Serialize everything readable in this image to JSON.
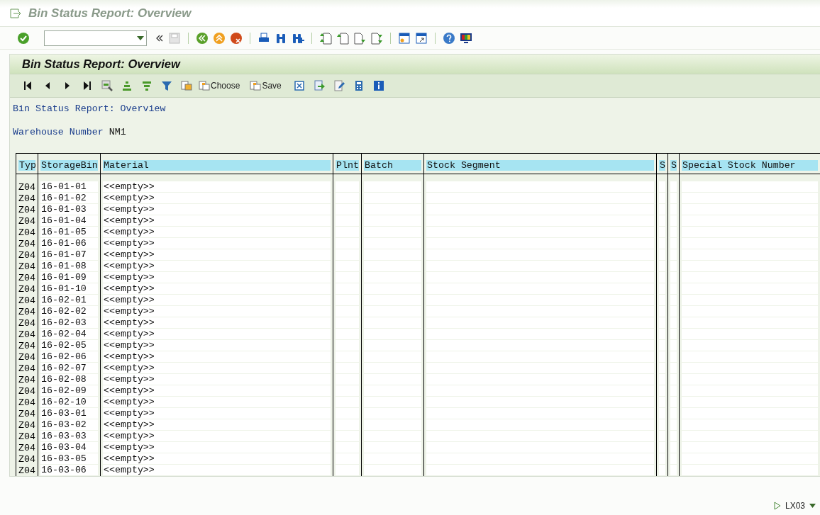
{
  "window": {
    "title": "Bin Status Report: Overview"
  },
  "panel": {
    "title": "Bin Status Report: Overview"
  },
  "app_toolbar": [
    {
      "kind": "icon"
    },
    {
      "kind": "icon"
    },
    {
      "kind": "icon"
    },
    {
      "kind": "icon"
    },
    {
      "kind": "icon"
    },
    {
      "kind": "icon"
    },
    {
      "kind": "icon"
    },
    {
      "kind": "icon"
    },
    {
      "kind": "icon"
    },
    {
      "kind": "text",
      "label": "Choose"
    },
    {
      "kind": "text",
      "label": "Save"
    },
    {
      "kind": "icon"
    },
    {
      "kind": "icon"
    },
    {
      "kind": "icon"
    },
    {
      "kind": "icon"
    },
    {
      "kind": "icon"
    }
  ],
  "report": {
    "heading": "Bin Status Report: Overview",
    "warehouse_label": "Warehouse Number",
    "warehouse_value": "NM1"
  },
  "table": {
    "columns": [
      "Typ",
      "StorageBin",
      "Material",
      "Plnt",
      "Batch",
      "Stock Segment",
      "S",
      "S",
      "Special Stock Number"
    ],
    "rows": [
      [
        "Z04",
        "16-01-01",
        "<<empty>>"
      ],
      [
        "Z04",
        "16-01-02",
        "<<empty>>"
      ],
      [
        "Z04",
        "16-01-03",
        "<<empty>>"
      ],
      [
        "Z04",
        "16-01-04",
        "<<empty>>"
      ],
      [
        "Z04",
        "16-01-05",
        "<<empty>>"
      ],
      [
        "Z04",
        "16-01-06",
        "<<empty>>"
      ],
      [
        "Z04",
        "16-01-07",
        "<<empty>>"
      ],
      [
        "Z04",
        "16-01-08",
        "<<empty>>"
      ],
      [
        "Z04",
        "16-01-09",
        "<<empty>>"
      ],
      [
        "Z04",
        "16-01-10",
        "<<empty>>"
      ],
      [
        "Z04",
        "16-02-01",
        "<<empty>>"
      ],
      [
        "Z04",
        "16-02-02",
        "<<empty>>"
      ],
      [
        "Z04",
        "16-02-03",
        "<<empty>>"
      ],
      [
        "Z04",
        "16-02-04",
        "<<empty>>"
      ],
      [
        "Z04",
        "16-02-05",
        "<<empty>>"
      ],
      [
        "Z04",
        "16-02-06",
        "<<empty>>"
      ],
      [
        "Z04",
        "16-02-07",
        "<<empty>>"
      ],
      [
        "Z04",
        "16-02-08",
        "<<empty>>"
      ],
      [
        "Z04",
        "16-02-09",
        "<<empty>>"
      ],
      [
        "Z04",
        "16-02-10",
        "<<empty>>"
      ],
      [
        "Z04",
        "16-03-01",
        "<<empty>>"
      ],
      [
        "Z04",
        "16-03-02",
        "<<empty>>"
      ],
      [
        "Z04",
        "16-03-03",
        "<<empty>>"
      ],
      [
        "Z04",
        "16-03-04",
        "<<empty>>"
      ],
      [
        "Z04",
        "16-03-05",
        "<<empty>>"
      ],
      [
        "Z04",
        "16-03-06",
        "<<empty>>"
      ]
    ]
  },
  "status_bar": {
    "transaction": "LX03"
  }
}
